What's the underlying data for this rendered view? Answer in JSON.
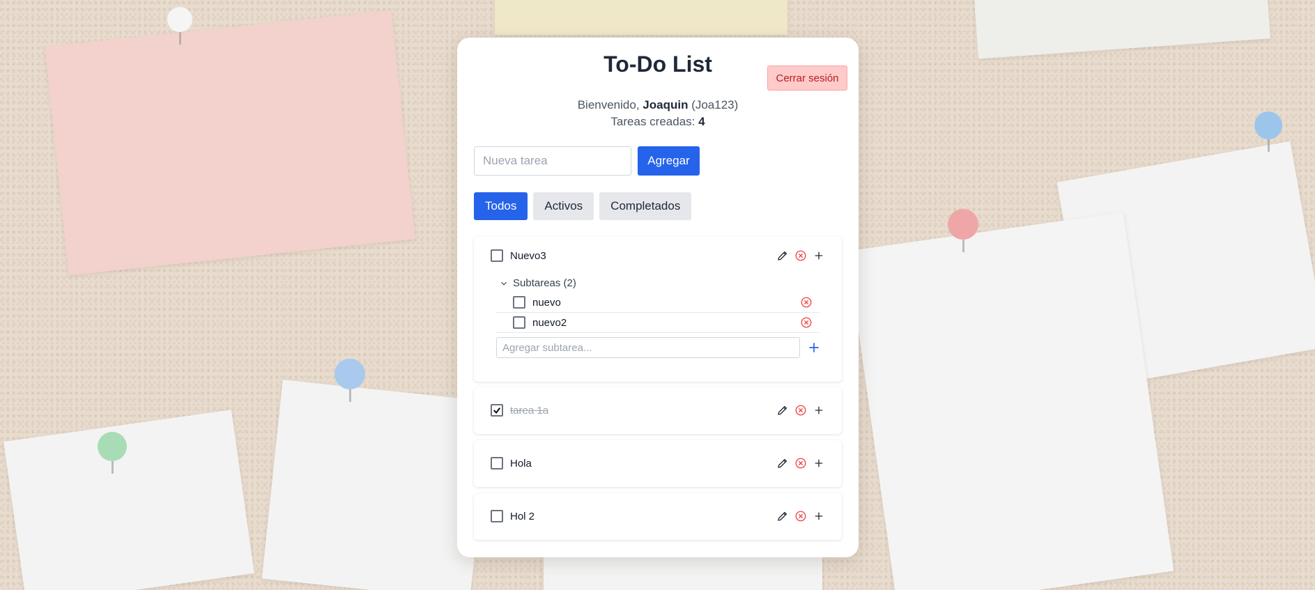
{
  "app": {
    "title": "To-Do List",
    "logout_label": "Cerrar sesión"
  },
  "user": {
    "greeting": "Bienvenido,",
    "name": "Joaquin",
    "username": "(Joa123)",
    "tasks_label": "Tareas creadas:",
    "tasks_count": "4"
  },
  "new_task": {
    "placeholder": "Nueva tarea",
    "add_label": "Agregar"
  },
  "filters": [
    {
      "label": "Todos",
      "active": true
    },
    {
      "label": "Activos",
      "active": false
    },
    {
      "label": "Completados",
      "active": false
    }
  ],
  "tasks": [
    {
      "label": "Nuevo3",
      "completed": false,
      "subtasks_header": "Subtareas (2)",
      "subtasks": [
        {
          "label": "nuevo",
          "completed": false
        },
        {
          "label": "nuevo2",
          "completed": false
        }
      ],
      "subtask_placeholder": "Agregar subtarea..."
    },
    {
      "label": "tarea 1a",
      "completed": true
    },
    {
      "label": "Hola",
      "completed": false
    },
    {
      "label": "Hol 2",
      "completed": false
    }
  ],
  "icons": {
    "edit": "pencil-icon",
    "delete": "circle-x-icon",
    "add": "plus-icon",
    "collapse": "chevron-down-icon"
  },
  "colors": {
    "primary": "#2563eb",
    "danger": "#ef4444",
    "logout_bg": "#fecaca"
  }
}
